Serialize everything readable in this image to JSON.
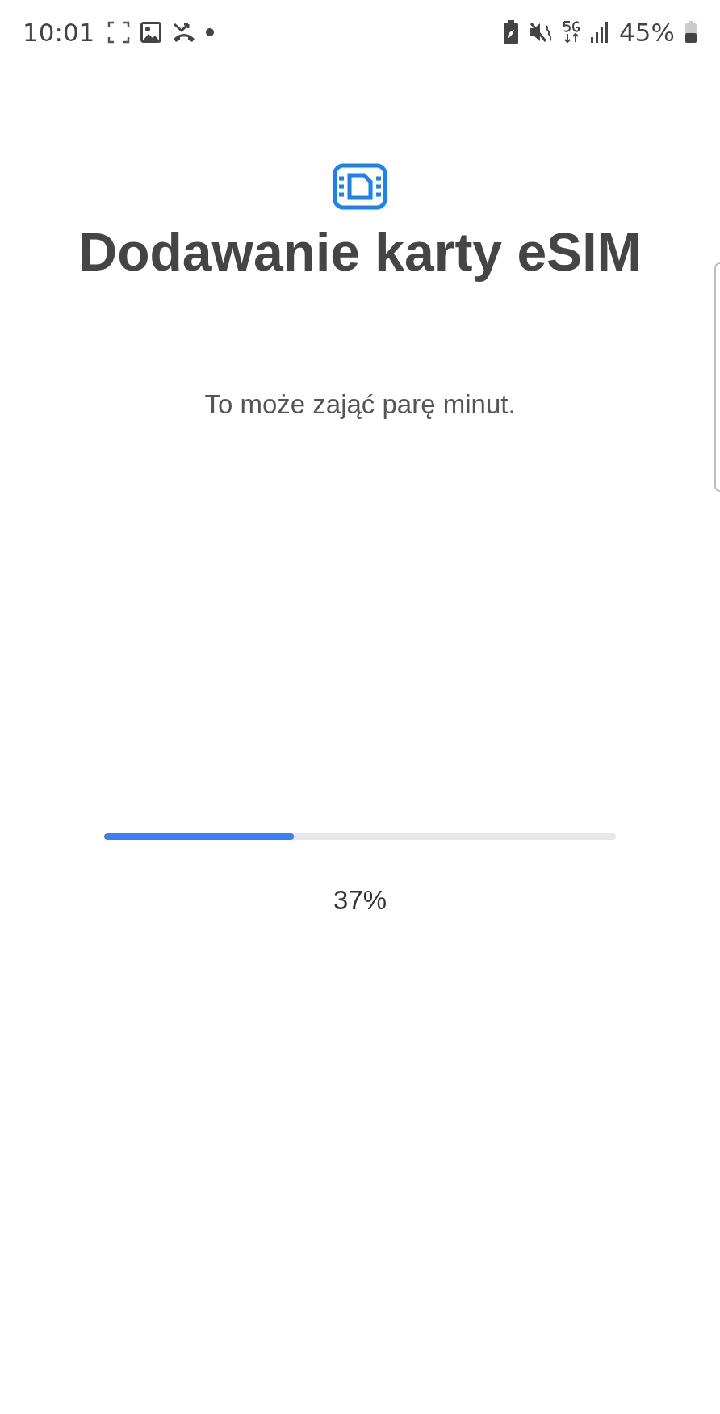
{
  "status_bar": {
    "time": "10:01",
    "battery": "45%"
  },
  "title": "Dodawanie karty eSIM",
  "subtitle": "To może zająć parę minut.",
  "progress": {
    "level": 0.37,
    "reading": "37%"
  }
}
